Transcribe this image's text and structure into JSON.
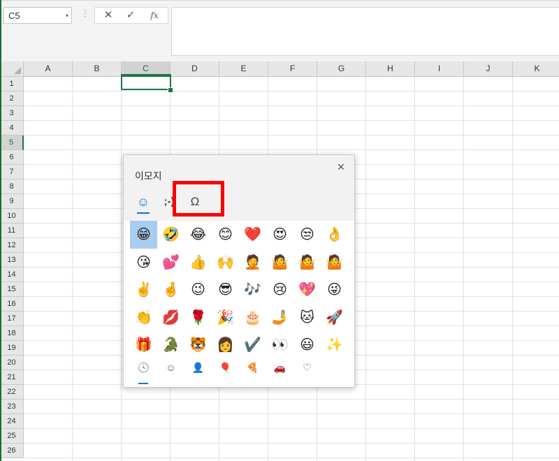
{
  "formula_bar": {
    "name_box": "C5",
    "name_box_arrow": "▾",
    "separator": "⋮",
    "cancel": "✕",
    "enter": "✓",
    "fx": "fx",
    "formula": ""
  },
  "grid": {
    "columns": [
      "A",
      "B",
      "C",
      "D",
      "E",
      "F",
      "G",
      "H",
      "I",
      "J",
      "K"
    ],
    "selected_column": "C",
    "rows": [
      "1",
      "2",
      "3",
      "4",
      "5",
      "6",
      "7",
      "8",
      "9",
      "10",
      "11",
      "12",
      "13",
      "14",
      "15",
      "16",
      "17",
      "18",
      "19",
      "20",
      "21",
      "22",
      "23",
      "24",
      "25",
      "26"
    ],
    "selected_row": "5",
    "active_cell": "C5"
  },
  "emoji_panel": {
    "title": "이모지",
    "close": "×",
    "tabs": [
      {
        "name": "emoji",
        "icon": "☺"
      },
      {
        "name": "kaomoji",
        "icon": ";-)"
      },
      {
        "name": "symbols",
        "icon": "Ω"
      }
    ],
    "emojis": [
      "😁",
      "🤣",
      "😂",
      "😊",
      "❤️",
      "😍",
      "😒",
      "👌",
      "😘",
      "💕",
      "👍",
      "🙌",
      "🤦",
      "🤷",
      "🤷",
      "🤷",
      "✌️",
      "🤞",
      "😉",
      "😎",
      "🎶",
      "😢",
      "💖",
      "😜",
      "👏",
      "💋",
      "🌹",
      "🎉",
      "🎂",
      "🤳",
      "🐱",
      "🚀",
      "🎁",
      "🐊",
      "🐯",
      "👩",
      "✔️",
      "👀",
      "😃",
      "✨"
    ],
    "selected_emoji_index": 0,
    "categories": [
      {
        "name": "recent",
        "icon": "🕓"
      },
      {
        "name": "smileys",
        "icon": "☺"
      },
      {
        "name": "people",
        "icon": "👤"
      },
      {
        "name": "celebrations",
        "icon": "🎈"
      },
      {
        "name": "food",
        "icon": "🍕"
      },
      {
        "name": "travel",
        "icon": "🚗"
      },
      {
        "name": "symbols",
        "icon": "♡"
      }
    ],
    "highlight_color": "#ff0000",
    "accent_color": "#0078d7"
  }
}
